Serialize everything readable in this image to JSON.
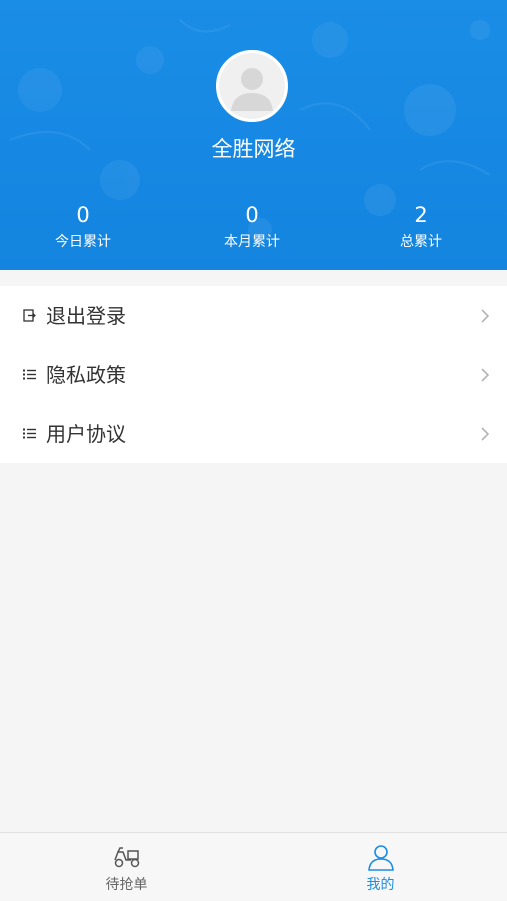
{
  "profile": {
    "username": "全胜网络"
  },
  "stats": [
    {
      "value": "0",
      "label": "今日累计"
    },
    {
      "value": "0",
      "label": "本月累计"
    },
    {
      "value": "2",
      "label": "总累计"
    }
  ],
  "menu": [
    {
      "label": "退出登录",
      "icon": "logout-icon"
    },
    {
      "label": "隐私政策",
      "icon": "list-icon"
    },
    {
      "label": "用户协议",
      "icon": "list-icon"
    }
  ],
  "tabbar": {
    "tabs": [
      {
        "label": "待抢单",
        "icon": "delivery-scooter-icon",
        "active": false
      },
      {
        "label": "我的",
        "icon": "user-icon",
        "active": true
      }
    ]
  },
  "colors": {
    "header_blue": "#1688e3",
    "tab_active": "#1a8de6",
    "tab_inactive": "#666666"
  }
}
